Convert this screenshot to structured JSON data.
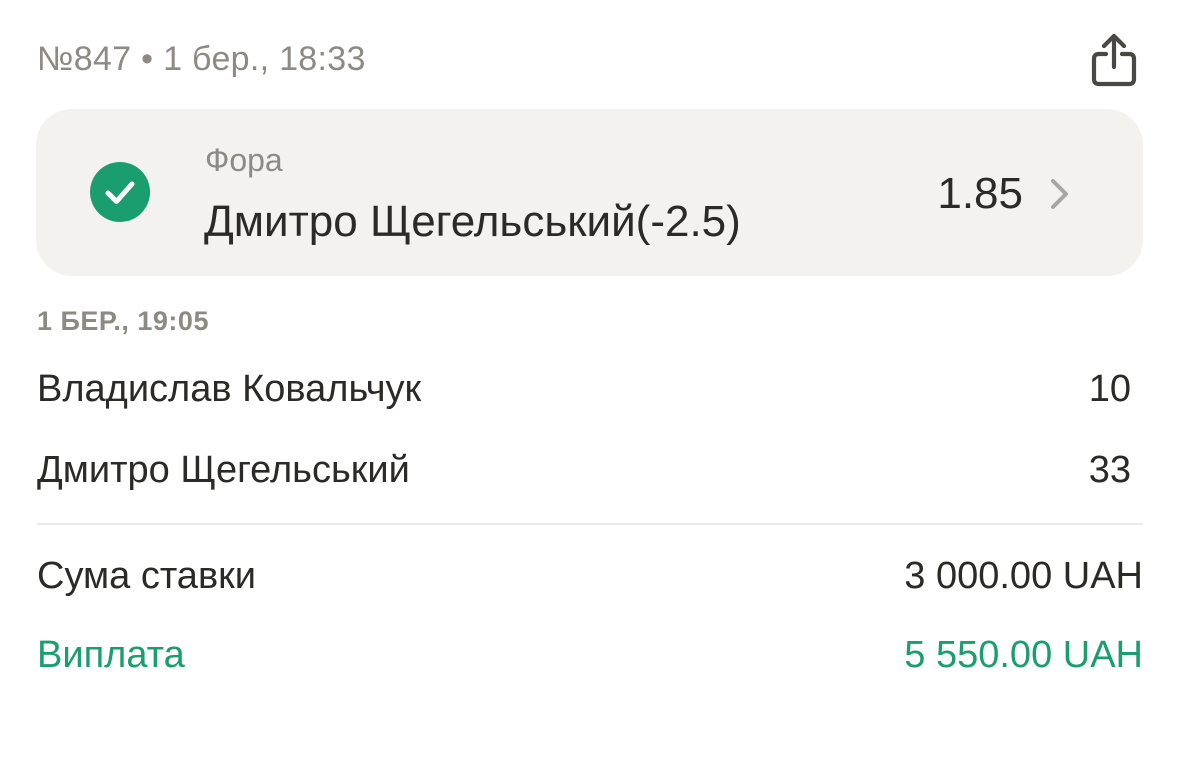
{
  "header": {
    "meta": "№847 • 1 бер., 18:33",
    "share_icon": "share-icon"
  },
  "bet": {
    "status_icon": "check-circle-icon",
    "status_color": "#1a9e6e",
    "market": "Фора",
    "selection": "Дмитро Щегельський(-2.5)",
    "odds": "1.85",
    "chevron_icon": "chevron-right-icon"
  },
  "result": {
    "time": "1 БЕР., 19:05",
    "players": [
      {
        "name": "Владислав Ковальчук",
        "score": "10"
      },
      {
        "name": "Дмитро Щегельський",
        "score": "33"
      }
    ]
  },
  "summary": {
    "stake_label": "Сума ставки",
    "stake_value": "3 000.00 UAH",
    "payout_label": "Виплата",
    "payout_value": "5 550.00 UAH",
    "payout_color": "#1a9e6e"
  }
}
